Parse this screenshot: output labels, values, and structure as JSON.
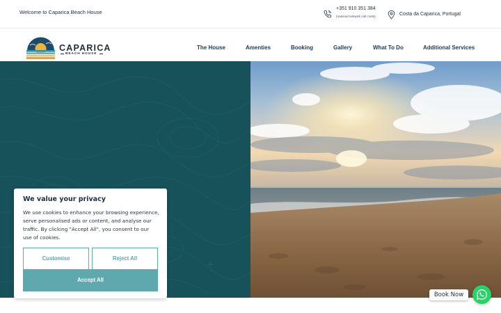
{
  "topbar": {
    "welcome": "Welcome to Caparica Beach House",
    "phone": "+351 910 351 384",
    "phone_note": "(national network call costs)",
    "location": "Costa da Caparica, Portugal"
  },
  "logo": {
    "name": "CAPARICA",
    "subtitle": "BEACH HOUSE"
  },
  "nav": {
    "items": [
      {
        "label": "The House"
      },
      {
        "label": "Amenties"
      },
      {
        "label": "Booking"
      },
      {
        "label": "Gallery"
      },
      {
        "label": "What To Do"
      },
      {
        "label": "Additional Services"
      }
    ]
  },
  "cookie": {
    "title": "We value your privacy",
    "text": "We use cookies to enhance your browsing experience, serve personalised ads or content, and analyse our traffic. By clicking \"Accept All\", you consent to our use of cookies.",
    "customise_label": "Customise",
    "reject_label": "Reject All",
    "accept_label": "Accept All"
  },
  "book": {
    "label": "Book Now"
  },
  "colors": {
    "hero_left": "#17525b",
    "accent": "#5fa8ae",
    "nav_text": "#1e3a55",
    "whatsapp": "#25d366"
  },
  "icons": {
    "phone": "phone-icon",
    "location": "map-pin-icon",
    "whatsapp": "whatsapp-icon"
  }
}
